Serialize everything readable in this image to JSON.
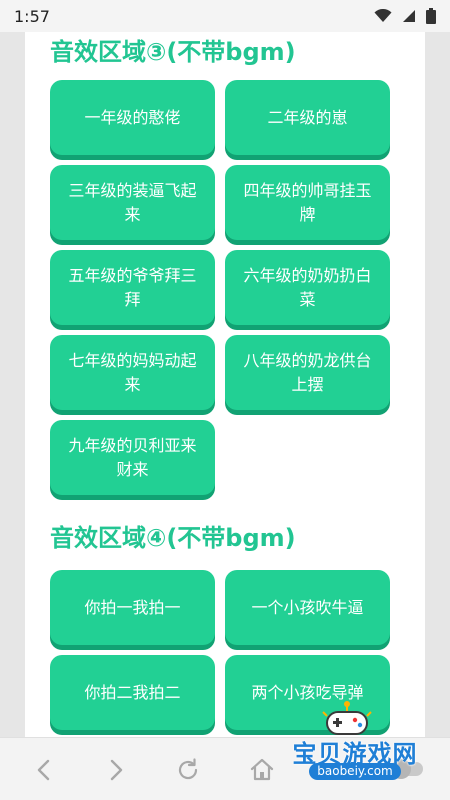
{
  "status_bar": {
    "time": "1:57"
  },
  "sections": [
    {
      "title": "音效区域③(不带bgm)",
      "buttons": [
        {
          "line1": "一年级的憨佬",
          "line2": ""
        },
        {
          "line1": "二年级的崽",
          "line2": ""
        },
        {
          "line1": "三年级的装逼飞起",
          "line2": "来"
        },
        {
          "line1": "四年级的帅哥挂玉",
          "line2": "牌"
        },
        {
          "line1": "五年级的爷爷拜三",
          "line2": "拜"
        },
        {
          "line1": "六年级的奶奶扔白",
          "line2": "菜"
        },
        {
          "line1": "七年级的妈妈动起",
          "line2": "来"
        },
        {
          "line1": "八年级的奶龙供台",
          "line2": "上摆"
        },
        {
          "line1": "九年级的贝利亚来",
          "line2": "财来"
        }
      ]
    },
    {
      "title": "音效区域④(不带bgm)",
      "buttons": [
        {
          "line1": "你拍一我拍一",
          "line2": ""
        },
        {
          "line1": "一个小孩吹牛逼",
          "line2": ""
        },
        {
          "line1": "你拍二我拍二",
          "line2": ""
        },
        {
          "line1": "两个小孩吃导弹",
          "line2": ""
        }
      ]
    }
  ],
  "toolbar": {
    "icons": [
      "back-icon",
      "forward-icon",
      "reload-icon",
      "home-icon"
    ],
    "toggle_state": "off"
  },
  "watermark": {
    "text": "宝贝游戏网",
    "url": "baobeiy.com"
  },
  "colors": {
    "accent": "#22c592",
    "card": "#22d094",
    "card_shadow": "#11a273",
    "watermark": "#1f7fd6"
  }
}
